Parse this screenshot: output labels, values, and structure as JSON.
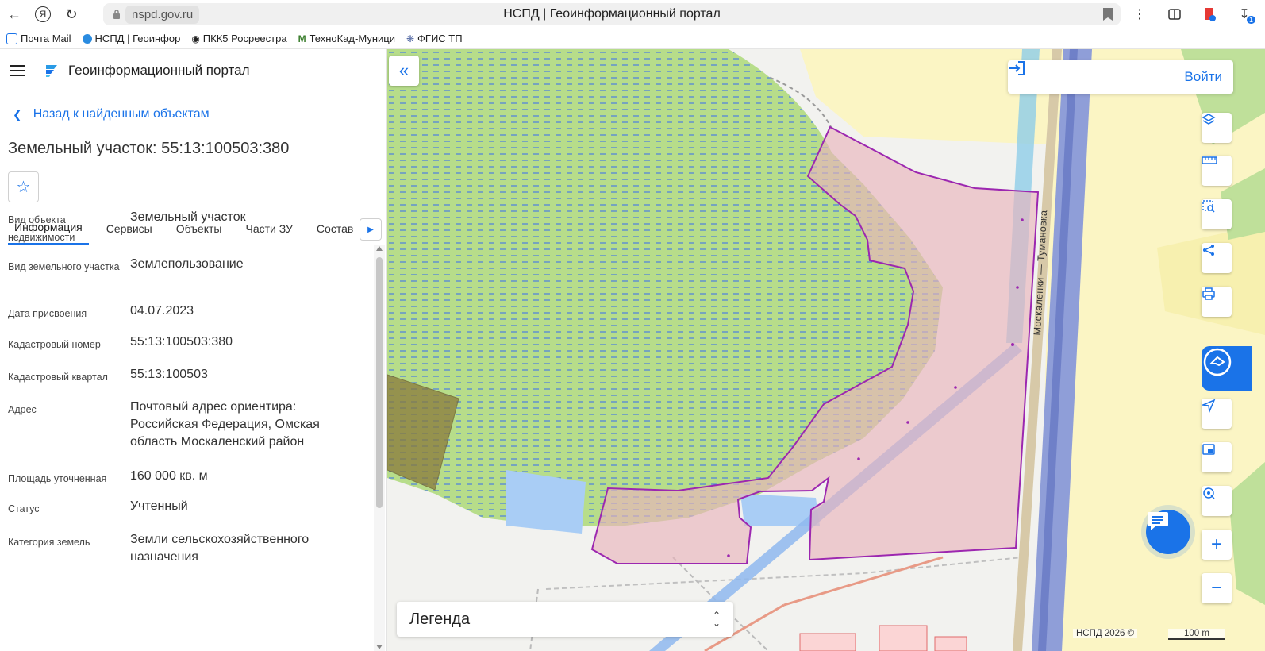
{
  "browser": {
    "url": "nspd.gov.ru",
    "title": "НСПД | Геоинформационный портал",
    "bookmarks": [
      {
        "label": "Почта Mail",
        "icon": "mail-icon",
        "color": "#1a73e8"
      },
      {
        "label": "НСПД | Геоинфор",
        "icon": "nspd-icon",
        "color": "#2a8be0"
      },
      {
        "label": "ПКК5 Росреестра",
        "icon": "pin-icon",
        "color": "#333333"
      },
      {
        "label": "ТехноКад-Муници",
        "icon": "m-logo-icon",
        "color": "#3a7d2c"
      },
      {
        "label": "ФГИС ТП",
        "icon": "emblem-icon",
        "color": "#5a6fa8"
      }
    ],
    "download_count": "1"
  },
  "header": {
    "portal_title": "Геоинформационный портал"
  },
  "nav": {
    "back_label": "Назад к найденным объектам"
  },
  "object": {
    "title": "Земельный участок: 55:13:100503:380"
  },
  "tabs": [
    {
      "label": "Информация",
      "active": true
    },
    {
      "label": "Сервисы",
      "active": false
    },
    {
      "label": "Объекты",
      "active": false
    },
    {
      "label": "Части ЗУ",
      "active": false
    },
    {
      "label": "Состав",
      "active": false
    }
  ],
  "info": {
    "rows": [
      {
        "key": "Вид объекта недвижимости",
        "value": "Земельный участок"
      },
      {
        "key": "Вид земельного участка",
        "value": "Землепользование"
      },
      {
        "key": "Дата присвоения",
        "value": "04.07.2023"
      },
      {
        "key": "Кадастровый номер",
        "value": "55:13:100503:380"
      },
      {
        "key": "Кадастровый квартал",
        "value": "55:13:100503"
      },
      {
        "key": "Адрес",
        "value": "Почтовый адрес ориентира: Российская Федерация, Омская область Москаленский район"
      },
      {
        "key": "Площадь уточненная",
        "value": "160 000 кв. м"
      },
      {
        "key": "Статус",
        "value": "Учтенный"
      },
      {
        "key": "Категория земель",
        "value": "Земли сельскохозяйственного назначения"
      }
    ]
  },
  "map": {
    "login_label": "Войти",
    "legend_label": "Легенда",
    "road_label": "Москаленки — Тумановка",
    "copyright": "НСПД 2026 ©",
    "scale_label": "100 m",
    "tools": [
      "layers-icon",
      "ruler-icon",
      "area-select-icon",
      "share-icon",
      "print-icon",
      "navigate-icon",
      "minimap-icon",
      "geolocation-icon",
      "zoom-in-icon",
      "zoom-out-icon"
    ],
    "colors": {
      "accent": "#1a73e8",
      "parcel_fill": "#e8b4bc",
      "parcel_stroke": "#9c27b0",
      "grass": "#b7dd8a",
      "water": "#a9cdf5",
      "field": "#fbf5c4"
    }
  }
}
